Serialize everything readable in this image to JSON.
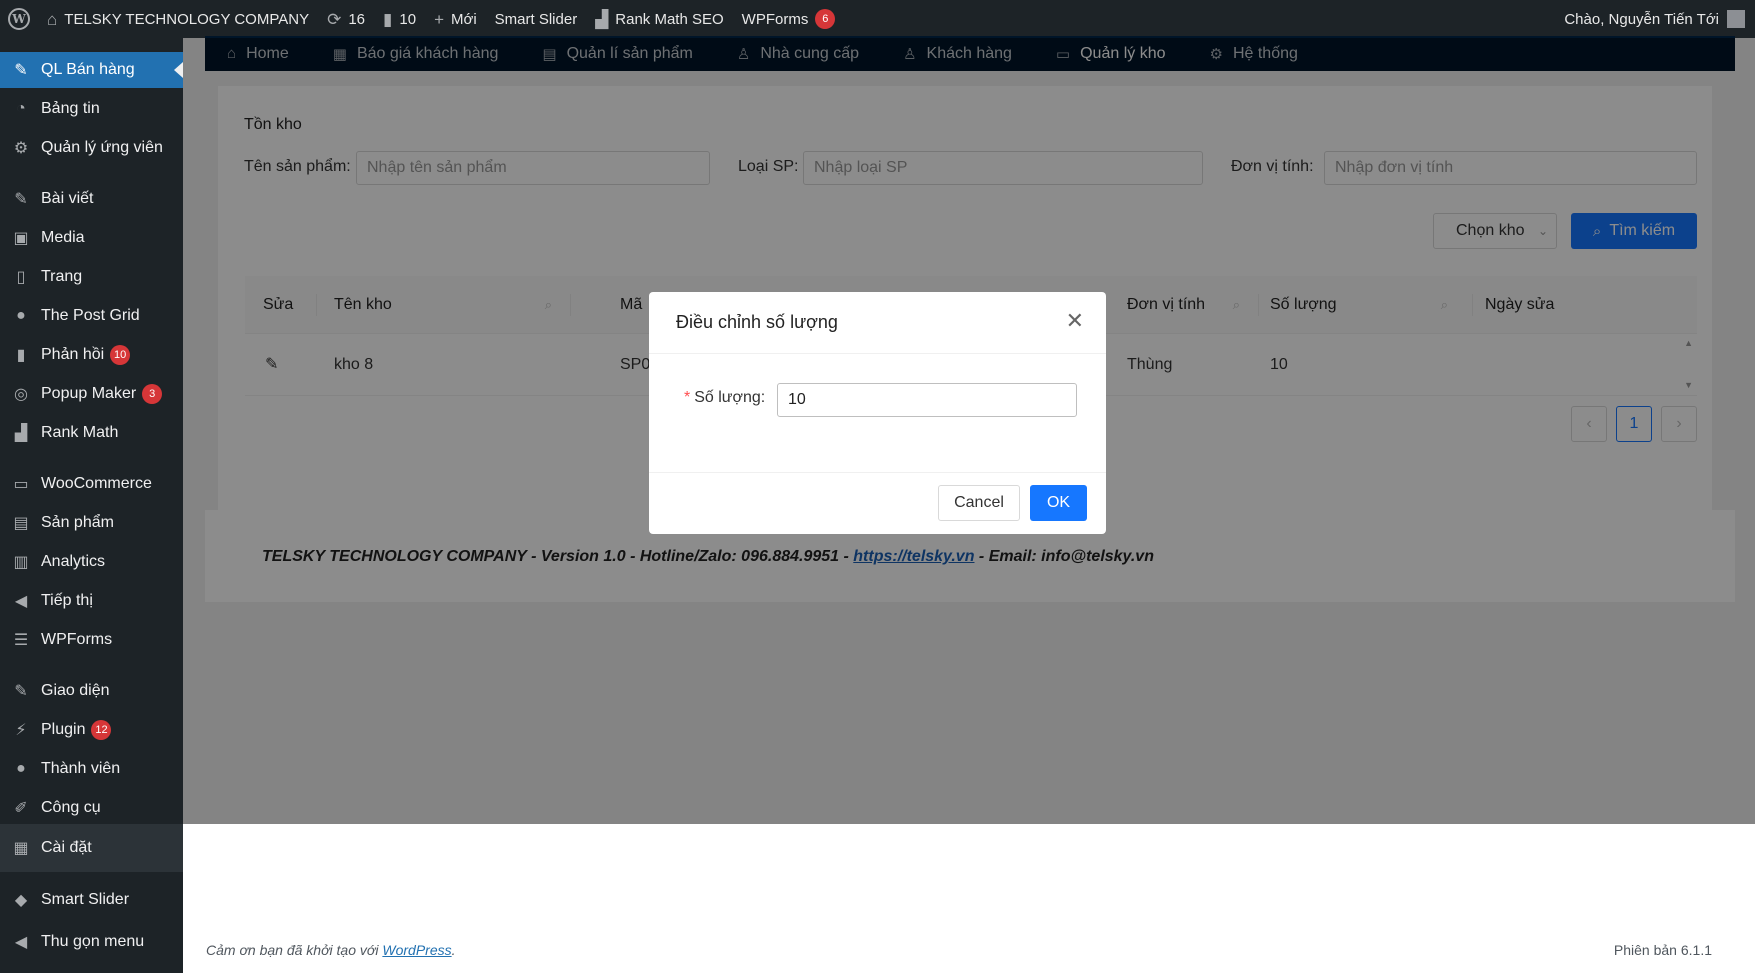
{
  "admin_bar": {
    "site_name": "TELSKY TECHNOLOGY COMPANY",
    "updates_count": "16",
    "comments_count": "10",
    "new_label": "Mới",
    "smart_slider": "Smart Slider",
    "rank_math": "Rank Math SEO",
    "wpforms": "WPForms",
    "wpforms_badge": "6",
    "greeting": "Chào, Nguyễn Tiến Tới"
  },
  "sidebar": {
    "items": [
      {
        "label": "QL Bán hàng",
        "icon": "pin-icon"
      },
      {
        "label": "Bảng tin",
        "icon": "dashboard-icon"
      },
      {
        "label": "Quản lý ứng viên",
        "icon": "gear-icon"
      },
      {
        "label": "Bài viết",
        "icon": "pin-icon"
      },
      {
        "label": "Media",
        "icon": "media-icon"
      },
      {
        "label": "Trang",
        "icon": "page-icon"
      },
      {
        "label": "The Post Grid",
        "icon": "grid-icon"
      },
      {
        "label": "Phản hồi",
        "icon": "comment-icon",
        "badge": "10"
      },
      {
        "label": "Popup Maker",
        "icon": "popup-icon",
        "badge": "3"
      },
      {
        "label": "Rank Math",
        "icon": "chart-icon"
      },
      {
        "label": "WooCommerce",
        "icon": "woo-icon"
      },
      {
        "label": "Sản phẩm",
        "icon": "box-icon"
      },
      {
        "label": "Analytics",
        "icon": "bar-chart-icon"
      },
      {
        "label": "Tiếp thị",
        "icon": "megaphone-icon"
      },
      {
        "label": "WPForms",
        "icon": "form-icon"
      },
      {
        "label": "Giao diện",
        "icon": "brush-icon"
      },
      {
        "label": "Plugin",
        "icon": "plug-icon",
        "badge": "12"
      },
      {
        "label": "Thành viên",
        "icon": "user-icon"
      },
      {
        "label": "Công cụ",
        "icon": "wrench-icon"
      },
      {
        "label": "Cài đặt",
        "icon": "settings-icon"
      },
      {
        "label": "Smart Slider",
        "icon": "slider-icon"
      },
      {
        "label": "Thu gọn menu",
        "icon": "collapse-icon"
      }
    ]
  },
  "topnav": {
    "items": [
      {
        "label": "Home",
        "icon": "home-icon"
      },
      {
        "label": "Báo giá khách hàng",
        "icon": "table-icon"
      },
      {
        "label": "Quản lí sản phẩm",
        "icon": "list-icon"
      },
      {
        "label": "Nhà cung cấp",
        "icon": "user-icon"
      },
      {
        "label": "Khách hàng",
        "icon": "user-icon"
      },
      {
        "label": "Quản lý kho",
        "icon": "inbox-icon"
      },
      {
        "label": "Hệ thống",
        "icon": "gear-icon"
      }
    ],
    "active": "Quản lý kho"
  },
  "filters": {
    "title": "Tồn kho",
    "product_name_label": "Tên sản phẩm:",
    "product_name_placeholder": "Nhập tên sản phẩm",
    "product_type_label": "Loại SP:",
    "product_type_placeholder": "Nhập loại SP",
    "unit_label": "Đơn vị tính:",
    "unit_placeholder": "Nhập đơn vị tính",
    "warehouse_select": "Chọn kho",
    "search_button": "Tìm kiếm"
  },
  "table": {
    "headers": [
      "Sửa",
      "Tên kho",
      "Mã",
      "Đơn vị tính",
      "Số lượng",
      "Ngày sửa"
    ],
    "rows": [
      {
        "name": "kho 8",
        "code": "SP0",
        "unit": "Thùng",
        "qty": "10",
        "date": ""
      }
    ],
    "page": "1"
  },
  "footer": {
    "text_before": "TELSKY TECHNOLOGY COMPANY - Version 1.0 - Hotline/Zalo: 096.884.9951 - ",
    "link": "https://telsky.vn",
    "text_after": " - Email: info@telsky.vn"
  },
  "modal": {
    "title": "Điều chỉnh số lượng",
    "field_label": "Số lượng:",
    "field_value": "10",
    "cancel": "Cancel",
    "ok": "OK"
  },
  "wp_footer": {
    "thanks": "Cảm ơn bạn đã khởi tạo với ",
    "wordpress": "WordPress",
    "dot": ".",
    "version": "Phiên bản 6.1.1"
  },
  "colors": {
    "primary": "#1677ff",
    "admin_dark": "#1d2327",
    "nav_dark": "#001529",
    "badge_red": "#d63638"
  }
}
